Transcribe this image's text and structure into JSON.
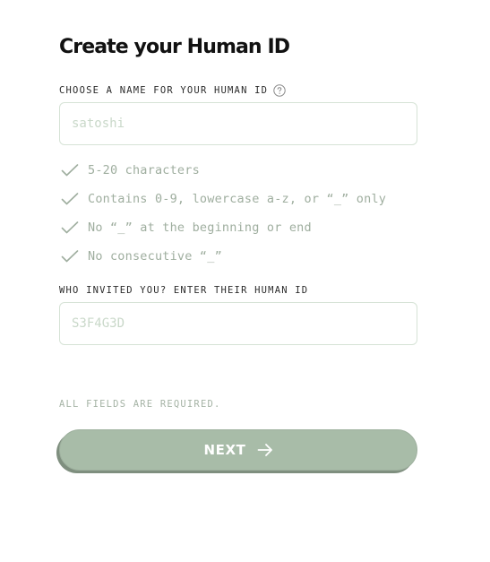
{
  "page": {
    "title": "Create your Human ID"
  },
  "name_field": {
    "label": "CHOOSE A NAME FOR YOUR HUMAN ID",
    "help_icon": "question-circle-icon",
    "value": "",
    "placeholder": "satoshi"
  },
  "rules": [
    {
      "icon": "check-icon",
      "text": "5-20 characters"
    },
    {
      "icon": "check-icon",
      "text": "Contains 0-9, lowercase a-z, or “_” only"
    },
    {
      "icon": "check-icon",
      "text": "No “_” at the beginning or end"
    },
    {
      "icon": "check-icon",
      "text": "No consecutive “_”"
    }
  ],
  "invite_field": {
    "label": "WHO INVITED YOU? ENTER THEIR HUMAN ID",
    "value": "",
    "placeholder": "S3F4G3D"
  },
  "required_note": "ALL FIELDS ARE REQUIRED.",
  "next_button": {
    "label": "NEXT",
    "icon": "arrow-right-icon"
  },
  "colors": {
    "accent": "#a8bca8",
    "rule_text": "#9fae9f",
    "input_border": "#d6e3d6"
  }
}
